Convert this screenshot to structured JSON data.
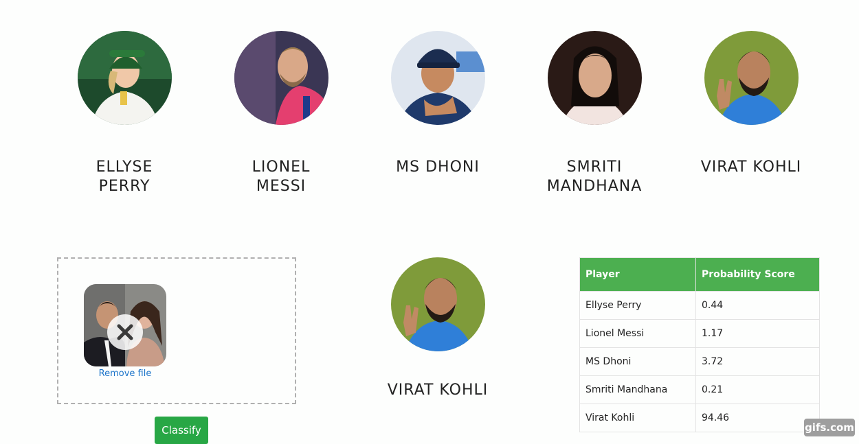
{
  "players": [
    {
      "name": "ELLYSE PERRY"
    },
    {
      "name": "LIONEL MESSI"
    },
    {
      "name": "MS DHONI"
    },
    {
      "name": "SMRITI MANDHANA"
    },
    {
      "name": "VIRAT KOHLI"
    }
  ],
  "upload": {
    "remove_label": "Remove file"
  },
  "classify_label": "Classify",
  "result": {
    "name": "VIRAT KOHLI"
  },
  "table": {
    "headers": [
      "Player",
      "Probability Score"
    ],
    "rows": [
      [
        "Ellyse Perry",
        "0.44"
      ],
      [
        "Lionel Messi",
        "1.17"
      ],
      [
        "MS Dhoni",
        "3.72"
      ],
      [
        "Smriti Mandhana",
        "0.21"
      ],
      [
        "Virat Kohli",
        "94.46"
      ]
    ]
  },
  "watermark": "gifs.com",
  "colors": {
    "accent_green": "#4caf50",
    "button_green": "#28a745",
    "link_blue": "#1a73c9"
  }
}
